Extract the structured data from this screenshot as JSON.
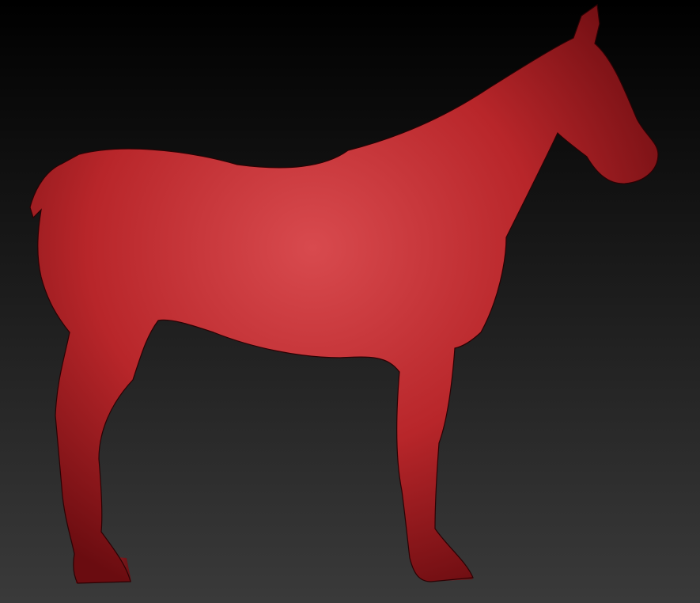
{
  "viewport": {
    "background_top": "#000000",
    "background_bottom": "#3a3a3a"
  },
  "model": {
    "subject": "horse",
    "material_color": "#b8262a",
    "material_highlight": "#d84a4e",
    "material_shadow": "#6a0c10",
    "wireframe_color": "#3a0406",
    "view": "side-right"
  }
}
